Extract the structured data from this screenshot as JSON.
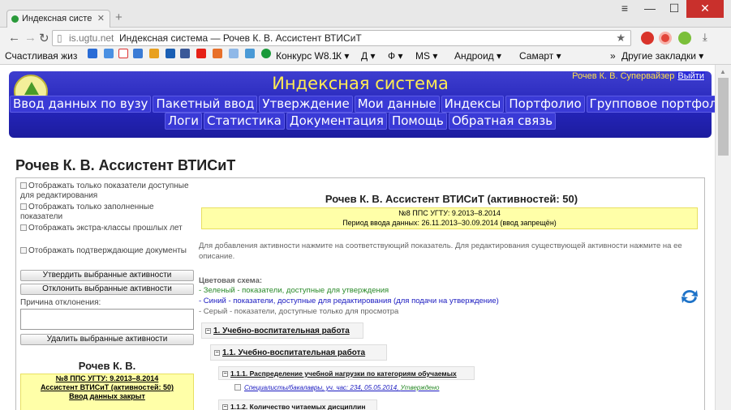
{
  "browser": {
    "tab_title": "Индексная систе",
    "url_host": "is.ugtu.net",
    "url_title": "Индексная система — Рочев К. В. Ассистент ВТИСиТ",
    "bookmarks": [
      "Счастливая жиз",
      "Конкурс W8.1",
      "К ▾",
      "Д ▾",
      "Ф ▾",
      "MS ▾",
      "Андроид ▾",
      "Самарт ▾"
    ],
    "bookmarks_more": "»",
    "other_bookmarks": "Другие закладки ▾"
  },
  "header": {
    "title": "Индексная система",
    "user": "Рочев К. В. Супервайзер",
    "logout": "Выйти",
    "logo_text": "ИС",
    "nav_row1": [
      "Ввод данных по вузу",
      "Пакетный ввод",
      "Утверждение",
      "Мои данные",
      "Индексы",
      "Портфолио",
      "Групповое портфолио"
    ],
    "nav_row2": [
      "Логи",
      "Статистика",
      "Документация",
      "Помощь",
      "Обратная связь"
    ]
  },
  "page_title": "Рочев К. В. Ассистент ВТИСиТ",
  "left": {
    "checkboxes": [
      "Отображать только показатели доступные для редактирования",
      "Отображать только заполненные показатели",
      "Отображать экстра-классы прошлых лет",
      "Отображать подтверждающие документы"
    ],
    "approve_button": "Утвердить выбранные активности",
    "reject_button": "Отклонить выбранные активности",
    "reason_label": "Причина отклонения:",
    "delete_button": "Удалить выбранные активности",
    "user_name": "Рочев К. В.",
    "user_lines": [
      "№8 ППС УГТУ: 9.2013–8.2014",
      "Ассистент ВТИСиТ (активностей: 50)",
      "Ввод данных закрыт"
    ]
  },
  "right": {
    "title": "Рочев К. В. Ассистент ВТИСиТ (активностей: 50)",
    "period_line1": "№8 ППС УГТУ: 9.2013–8.2014",
    "period_line2": "Период ввода данных: 26.11.2013–30.09.2014 (ввод запрещён)",
    "info": "Для добавления активности нажмите на соответствующий показатель. Для редактирования существующей активности нажмите на ее описание.",
    "scheme_title": "Цветовая схема:",
    "scheme_green": "- Зеленый - показатели, доступные для утверждения",
    "scheme_blue": "- Синий - показатели, доступные для редактирования (для подачи на утверждение)",
    "scheme_gray": "- Серый - показатели, доступные только для просмотра",
    "tree": {
      "n1": "1. Учебно-воспитательная работа",
      "n11": "1.1. Учебно-воспитательная работа",
      "n111": "1.1.1. Распределение учебной нагрузки по категориям обучаемых",
      "leaf": "Специалисты/бакалавры, уч. час: 234, 05.05.2014,",
      "leaf_status": "Утверждено",
      "n112": "1.1.2. Количество читаемых дисциплин"
    }
  },
  "colors": {
    "header_bg": "#2a2ac0",
    "title_yellow": "#ffec52",
    "highlight": "#ffffa8",
    "green": "#2a8a2a",
    "blue": "#1a1ac0"
  }
}
